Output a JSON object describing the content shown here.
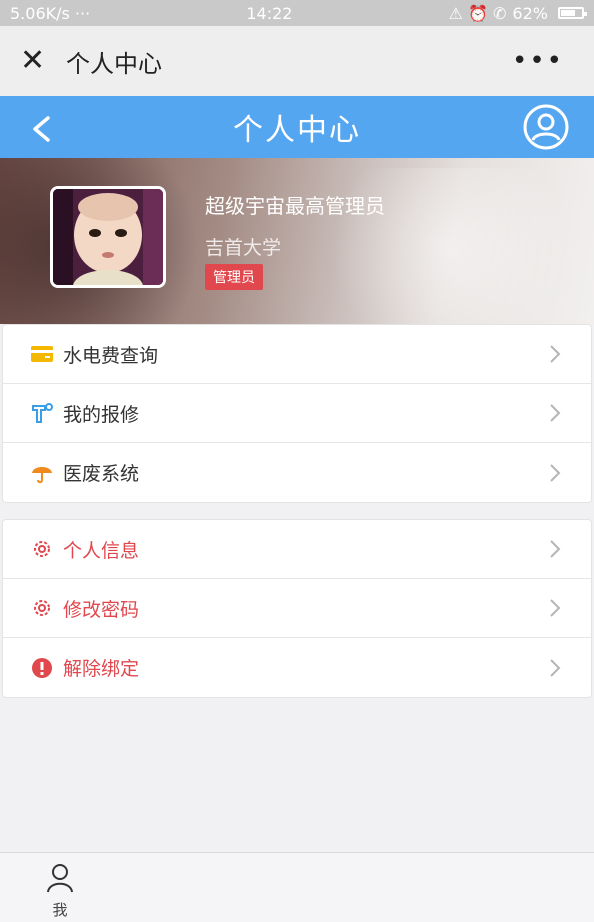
{
  "status_bar": {
    "signal": "5.06K/s ···",
    "time": "14:22",
    "right_icons": "⚠ ⏰ ✆",
    "battery": "62%"
  },
  "browser": {
    "title": "个人中心",
    "close_icon": "close-icon",
    "more_icon": "more-icon"
  },
  "header": {
    "title": "个人中心",
    "back_icon": "chevron-left-icon",
    "user_icon": "user-circle-icon",
    "color": "#55a6f0"
  },
  "profile": {
    "name": "超级宇宙最高管理员",
    "school": "吉首大学",
    "role": "管理员",
    "badge_color": "#e0484e"
  },
  "menu_group_1": [
    {
      "label": "水电费查询",
      "icon": "card-icon"
    },
    {
      "label": "我的报修",
      "icon": "repair-icon"
    },
    {
      "label": "医废系统",
      "icon": "umbrella-icon"
    }
  ],
  "menu_group_2": [
    {
      "label": "个人信息",
      "icon": "gear-icon"
    },
    {
      "label": "修改密码",
      "icon": "gear-icon"
    },
    {
      "label": "解除绑定",
      "icon": "alert-icon"
    }
  ],
  "tabbar": {
    "me_label": "我",
    "me_icon": "person-icon"
  }
}
